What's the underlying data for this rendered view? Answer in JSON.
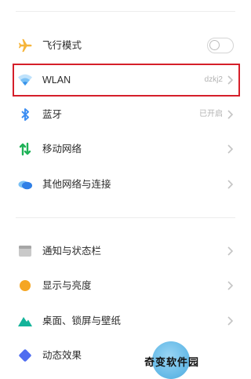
{
  "colors": {
    "accent": "#3d8ef2",
    "highlight_border": "#d51f2a",
    "airplane_icon": "#f6b53b",
    "display_icon": "#f5a623",
    "mobile_network_icon": "#1fb257",
    "wallpaper_icon": "#14b39a",
    "animation_icon": "#4f6df0"
  },
  "group1": [
    {
      "id": "airplane",
      "label": "飞行模式",
      "icon": "airplane-icon",
      "control": "toggle",
      "toggle_on": false
    },
    {
      "id": "wlan",
      "label": "WLAN",
      "value": "dzkj2",
      "icon": "wifi-icon",
      "control": "chevron",
      "highlighted": true
    },
    {
      "id": "bluetooth",
      "label": "蓝牙",
      "value": "已开启",
      "icon": "bluetooth-icon",
      "control": "chevron"
    },
    {
      "id": "mobile-network",
      "label": "移动网络",
      "icon": "mobile-data-icon",
      "control": "chevron"
    },
    {
      "id": "other-networks",
      "label": "其他网络与连接",
      "icon": "cloud-icon",
      "control": "chevron"
    }
  ],
  "group2": [
    {
      "id": "notifications",
      "label": "通知与状态栏",
      "icon": "notification-bar-icon",
      "control": "chevron"
    },
    {
      "id": "display",
      "label": "显示与亮度",
      "icon": "brightness-icon",
      "control": "chevron"
    },
    {
      "id": "wallpaper",
      "label": "桌面、锁屏与壁纸",
      "icon": "mountain-icon",
      "control": "chevron"
    },
    {
      "id": "animation",
      "label": "动态效果",
      "icon": "diamond-icon",
      "control": "chevron"
    }
  ],
  "watermark": {
    "text": "奇变软件园"
  }
}
